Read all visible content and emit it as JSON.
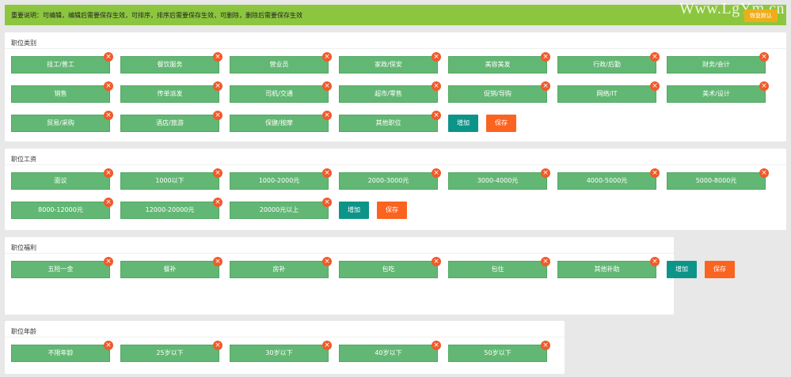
{
  "notice": {
    "text": "重要说明：可编辑，编辑后需要保存生效，可排序，排序后需要保存生效，可删除，删除后需要保存生效",
    "restore_label": "恢复默认"
  },
  "watermark": "Www.LgYm.cn",
  "sections": [
    {
      "title": "职位类别",
      "tags": [
        "技工/普工",
        "餐饮服务",
        "营业员",
        "家政/保安",
        "美容美发",
        "行政/后勤",
        "财务/会计",
        "销售",
        "传单派发",
        "司机/交通",
        "超市/零售",
        "促销/导购",
        "网络/IT",
        "美术/设计",
        "贸易/采购",
        "酒店/旅游",
        "保健/按摩",
        "其他职位"
      ],
      "add_label": "增加",
      "save_label": "保存"
    },
    {
      "title": "职位工资",
      "tags": [
        "面议",
        "1000以下",
        "1000-2000元",
        "2000-3000元",
        "3000-4000元",
        "4000-5000元",
        "5000-8000元",
        "8000-12000元",
        "12000-20000元",
        "20000元以上"
      ],
      "add_label": "增加",
      "save_label": "保存"
    },
    {
      "title": "职位福利",
      "tags": [
        "五险一金",
        "餐补",
        "房补",
        "包吃",
        "包住",
        "其他补助"
      ],
      "add_label": "增加",
      "save_label": "保存"
    },
    {
      "title": "职位年龄",
      "tags": [
        "不限年龄",
        "25岁以下",
        "30岁以下",
        "40岁以下",
        "50岁以下"
      ]
    }
  ],
  "colors": {
    "notice_bg": "#8cc63f",
    "tag_bg": "#63b774",
    "delete_badge": "#f05a2b",
    "add_button": "#0d9488",
    "save_button": "#fb6320",
    "restore_button": "#f0ad1a"
  },
  "icons": {
    "delete": "close-icon"
  }
}
